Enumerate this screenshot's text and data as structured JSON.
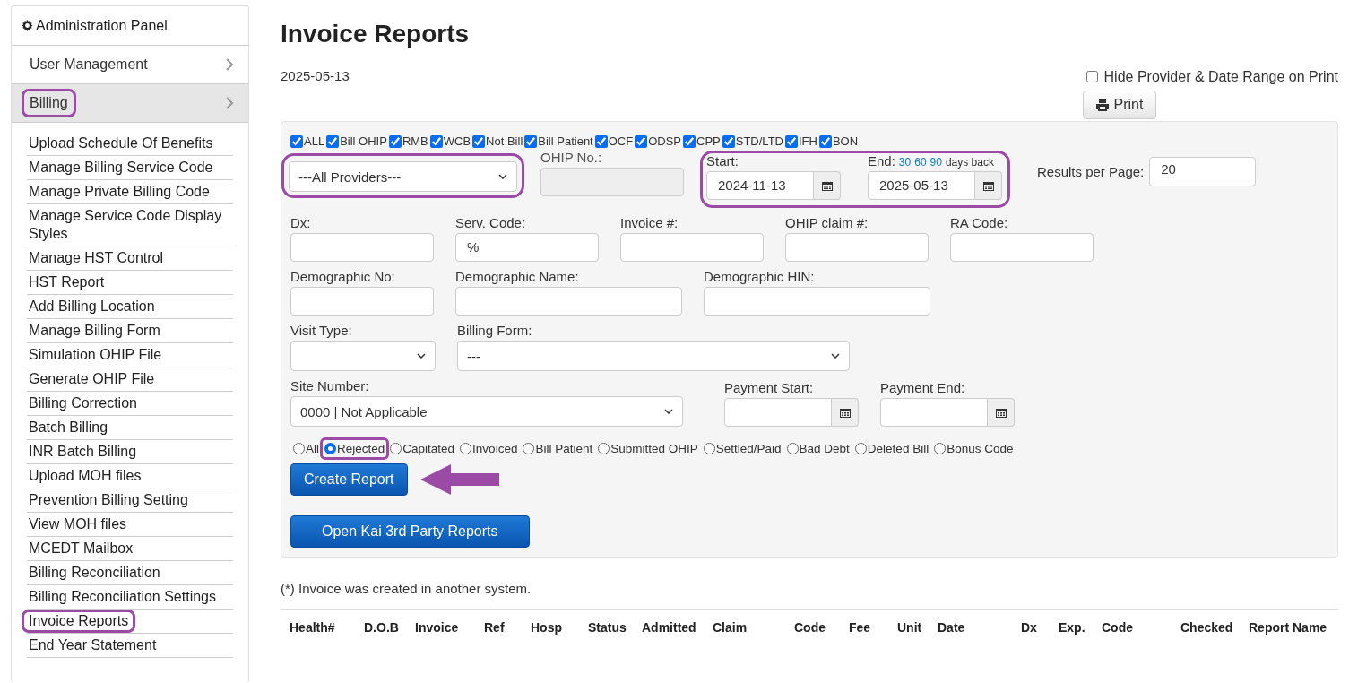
{
  "sidebar": {
    "title": "Administration Panel",
    "sections": [
      {
        "label": "User Management",
        "selected": false,
        "highlighted": false
      },
      {
        "label": "Billing",
        "selected": true,
        "highlighted": true
      }
    ],
    "items": [
      {
        "label": "Upload Schedule Of Benefits",
        "highlighted": false
      },
      {
        "label": "Manage Billing Service Code",
        "highlighted": false
      },
      {
        "label": "Manage Private Billing Code",
        "highlighted": false
      },
      {
        "label": "Manage Service Code Display Styles",
        "highlighted": false
      },
      {
        "label": "Manage HST Control",
        "highlighted": false
      },
      {
        "label": "HST Report",
        "highlighted": false
      },
      {
        "label": "Add Billing Location",
        "highlighted": false
      },
      {
        "label": "Manage Billing Form",
        "highlighted": false
      },
      {
        "label": "Simulation OHIP File",
        "highlighted": false
      },
      {
        "label": "Generate OHIP File",
        "highlighted": false
      },
      {
        "label": "Billing Correction",
        "highlighted": false
      },
      {
        "label": "Batch Billing",
        "highlighted": false
      },
      {
        "label": "INR Batch Billing",
        "highlighted": false
      },
      {
        "label": "Upload MOH files",
        "highlighted": false
      },
      {
        "label": "Prevention Billing Setting",
        "highlighted": false
      },
      {
        "label": "View MOH files",
        "highlighted": false
      },
      {
        "label": "MCEDT Mailbox",
        "highlighted": false
      },
      {
        "label": "Billing Reconciliation",
        "highlighted": false
      },
      {
        "label": "Billing Reconciliation Settings",
        "highlighted": false
      },
      {
        "label": "Invoice Reports",
        "highlighted": true
      },
      {
        "label": "End Year Statement",
        "highlighted": false
      }
    ]
  },
  "page": {
    "title": "Invoice Reports",
    "date": "2025-05-13"
  },
  "print_options": {
    "hide_label": "Hide Provider & Date Range on Print",
    "hide_checked": false,
    "print_button": "Print"
  },
  "filters": {
    "bill_types": [
      {
        "label": "ALL",
        "checked": true
      },
      {
        "label": "Bill OHIP",
        "checked": true
      },
      {
        "label": "RMB",
        "checked": true
      },
      {
        "label": "WCB",
        "checked": true
      },
      {
        "label": "Not Bill",
        "checked": true
      },
      {
        "label": "Bill Patient",
        "checked": true
      },
      {
        "label": "OCF",
        "checked": true
      },
      {
        "label": "ODSP",
        "checked": true
      },
      {
        "label": "CPP",
        "checked": true
      },
      {
        "label": "STD/LTD",
        "checked": true
      },
      {
        "label": "IFH",
        "checked": true
      },
      {
        "label": "BON",
        "checked": true
      }
    ],
    "provider": {
      "value": "---All Providers---",
      "highlighted": true
    },
    "ohip_no": {
      "label": "OHIP No.:"
    },
    "date_range": {
      "highlighted": true,
      "start_label": "Start:",
      "start": "2024-11-13",
      "end_label": "End:",
      "quick_days": [
        "30",
        "60",
        "90"
      ],
      "quick_suffix": "days back",
      "end": "2025-05-13"
    },
    "results_per_page": {
      "label": "Results per Page:",
      "value": "20"
    },
    "row2": [
      {
        "label": "Dx:"
      },
      {
        "label": "Serv. Code:",
        "value": "%"
      },
      {
        "label": "Invoice #:"
      },
      {
        "label": "OHIP claim #:"
      },
      {
        "label": "RA Code:"
      }
    ],
    "row3": [
      {
        "label": "Demographic No:",
        "wide": false
      },
      {
        "label": "Demographic Name:",
        "wide": true
      },
      {
        "label": "Demographic HIN:",
        "wide": true
      }
    ],
    "visit_type": {
      "label": "Visit Type:"
    },
    "billing_form": {
      "label": "Billing Form:",
      "value": "---"
    },
    "site_number": {
      "label": "Site Number:",
      "value": "0000 | Not Applicable"
    },
    "payment_start": {
      "label": "Payment Start:"
    },
    "payment_end": {
      "label": "Payment End:"
    },
    "statuses": [
      {
        "label": "All",
        "selected": false,
        "highlighted": false
      },
      {
        "label": "Rejected",
        "selected": true,
        "highlighted": true
      },
      {
        "label": "Capitated",
        "selected": false,
        "highlighted": false
      },
      {
        "label": "Invoiced",
        "selected": false,
        "highlighted": false
      },
      {
        "label": "Bill Patient",
        "selected": false,
        "highlighted": false
      },
      {
        "label": "Submitted OHIP",
        "selected": false,
        "highlighted": false
      },
      {
        "label": "Settled/Paid",
        "selected": false,
        "highlighted": false
      },
      {
        "label": "Bad Debt",
        "selected": false,
        "highlighted": false
      },
      {
        "label": "Deleted Bill",
        "selected": false,
        "highlighted": false
      },
      {
        "label": "Bonus Code",
        "selected": false,
        "highlighted": false
      }
    ],
    "create_button": "Create Report",
    "third_party_button": "Open Kai 3rd Party Reports"
  },
  "note": "(*) Invoice was created in another system.",
  "table": {
    "columns": [
      "Health#",
      "D.O.B",
      "Invoice",
      "Ref",
      "Hosp",
      "Status",
      "Admitted",
      "Claim",
      "Code",
      "Fee",
      "Unit",
      "Date",
      "Dx",
      "Exp.",
      "Code",
      "Checked",
      "Report Name"
    ]
  }
}
